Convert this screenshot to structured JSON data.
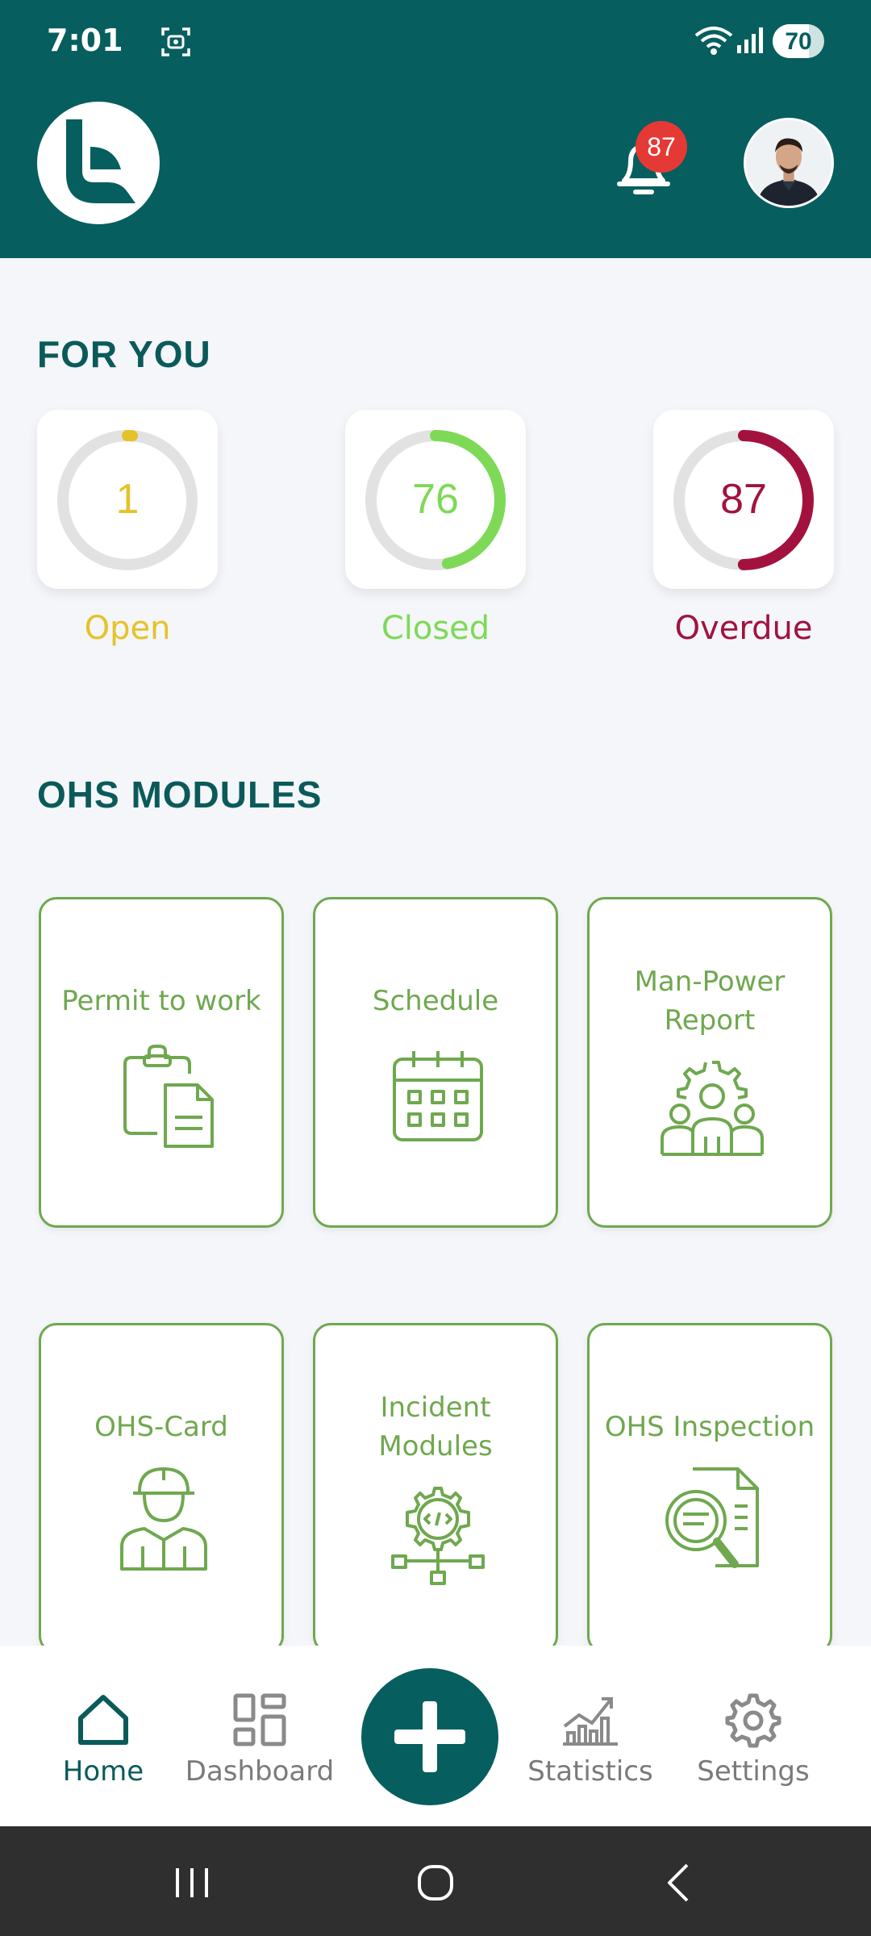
{
  "status_bar": {
    "time": "7:01",
    "battery": "70",
    "battery_level": 0.7
  },
  "header": {
    "notification_count": "87"
  },
  "for_you": {
    "title": "FOR YOU",
    "stats": [
      {
        "value": "1",
        "label": "Open",
        "color": "#e6c229",
        "fraction": 0.012
      },
      {
        "value": "76",
        "label": "Closed",
        "color": "#7ed957",
        "fraction": 0.47
      },
      {
        "value": "87",
        "label": "Overdue",
        "color": "#a3123e",
        "fraction": 0.5
      }
    ]
  },
  "modules": {
    "title": "OHS MODULES",
    "items": [
      {
        "label_lines": [
          "Permit to work"
        ],
        "icon": "clipboard-document-icon"
      },
      {
        "label_lines": [
          "Schedule"
        ],
        "icon": "calendar-icon"
      },
      {
        "label_lines": [
          "Man-Power",
          "Report"
        ],
        "icon": "team-gear-icon"
      },
      {
        "label_lines": [
          "OHS-Card"
        ],
        "icon": "worker-helmet-icon"
      },
      {
        "label_lines": [
          "Incident",
          "Modules"
        ],
        "icon": "code-gear-network-icon"
      },
      {
        "label_lines": [
          "OHS Inspection"
        ],
        "icon": "document-magnifier-icon"
      }
    ],
    "accent_color": "#6fa84f"
  },
  "bottom_nav": {
    "items": [
      {
        "label": "Home",
        "icon": "home-icon",
        "active": true
      },
      {
        "label": "Dashboard",
        "icon": "dashboard-icon",
        "active": false
      },
      {
        "label": "Statistics",
        "icon": "statistics-icon",
        "active": false
      },
      {
        "label": "Settings",
        "icon": "gear-icon",
        "active": false
      }
    ],
    "fab_icon": "plus-icon"
  },
  "colors": {
    "primary": "#075e5e",
    "background": "#f4f6f9"
  }
}
